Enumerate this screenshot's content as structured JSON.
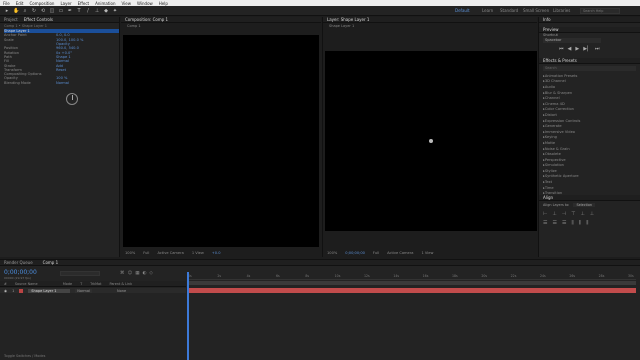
{
  "menu": [
    "File",
    "Edit",
    "Composition",
    "Layer",
    "Effect",
    "Animation",
    "View",
    "Window",
    "Help"
  ],
  "toolbar": {
    "tools": [
      "▸",
      "✋",
      "⌕",
      "↻",
      "⟲",
      "◫",
      "▭",
      "✒",
      "T",
      "/",
      "⊥",
      "◆",
      "✦"
    ],
    "workspaces": [
      "Default",
      "Learn",
      "Standard",
      "Small Screen",
      "Libraries"
    ],
    "search_placeholder": "Search Help"
  },
  "left_panel": {
    "tabs": [
      "Project",
      "Effect Controls"
    ],
    "source": "Comp 1 • Shape Layer 1",
    "properties": [
      {
        "name": "Shape Layer 1",
        "value": "",
        "selected": true
      },
      {
        "name": "Anchor Point",
        "value": "0.0, 0.0"
      },
      {
        "name": "Scale",
        "value": "100.0, 100.0 %"
      },
      {
        "name": "",
        "value": "Opacity"
      },
      {
        "name": "Position",
        "value": "960.0, 540.0"
      },
      {
        "name": "Rotation",
        "value": "0x +0.0°"
      },
      {
        "name": "Path",
        "value": "Shape 1"
      },
      {
        "name": "Fill",
        "value": "Normal"
      },
      {
        "name": "Stroke",
        "value": "Add"
      },
      {
        "name": "Transform",
        "value": "Reset"
      },
      {
        "name": "Compositing Options",
        "value": ""
      },
      {
        "name": "Opacity",
        "value": "100 %"
      },
      {
        "name": "Blending Mode",
        "value": "Normal"
      }
    ]
  },
  "center_viewer": {
    "tab": "Composition: Comp 1",
    "subtab": "Comp 1",
    "footer": [
      "100%",
      "Full",
      "Active Camera",
      "1 View",
      "+0.0"
    ]
  },
  "right_viewer": {
    "tab": "Layer: Shape Layer 1",
    "subtab": "Shape Layer 1",
    "footer": [
      "100%",
      "0;00;00;00",
      "Full",
      "Active Camera",
      "1 View"
    ]
  },
  "right_panel": {
    "info_tab": "Info",
    "preview_tab": "Preview",
    "preview_label": "Shortcut",
    "preview_value": "Spacebar",
    "effects_tab": "Effects & Presets",
    "search_placeholder": "Search",
    "effect_categories": [
      "Animation Presets",
      "3D Channel",
      "Audio",
      "Blur & Sharpen",
      "Channel",
      "Cinema 4D",
      "Color Correction",
      "Distort",
      "Expression Controls",
      "Generate",
      "Immersive Video",
      "Keying",
      "Matte",
      "Noise & Grain",
      "Obsolete",
      "Perspective",
      "Simulation",
      "Stylize",
      "Synthetic Aperture",
      "Text",
      "Time",
      "Transition",
      "Utility"
    ],
    "align_tab": "Align",
    "align_to_label": "Align Layers to:",
    "align_to_value": "Selection"
  },
  "timeline": {
    "tab": "Comp 1",
    "render_tab": "Render Queue",
    "timecode": "0;00;00;00",
    "fps": "00000 (29.97 fps)",
    "col_headers": [
      "#",
      "Source Name",
      "Mode",
      "T",
      "TrkMat",
      "Parent & Link"
    ],
    "layer_number": "1",
    "layer_name": "Shape Layer 1",
    "layer_mode": "Normal",
    "layer_parent": "None",
    "ruler": [
      "0s",
      "2s",
      "4s",
      "6s",
      "8s",
      "10s",
      "12s",
      "14s",
      "16s",
      "18s",
      "20s",
      "22s",
      "24s",
      "26s",
      "28s",
      "30s"
    ],
    "footer": "Toggle Switches / Modes"
  }
}
